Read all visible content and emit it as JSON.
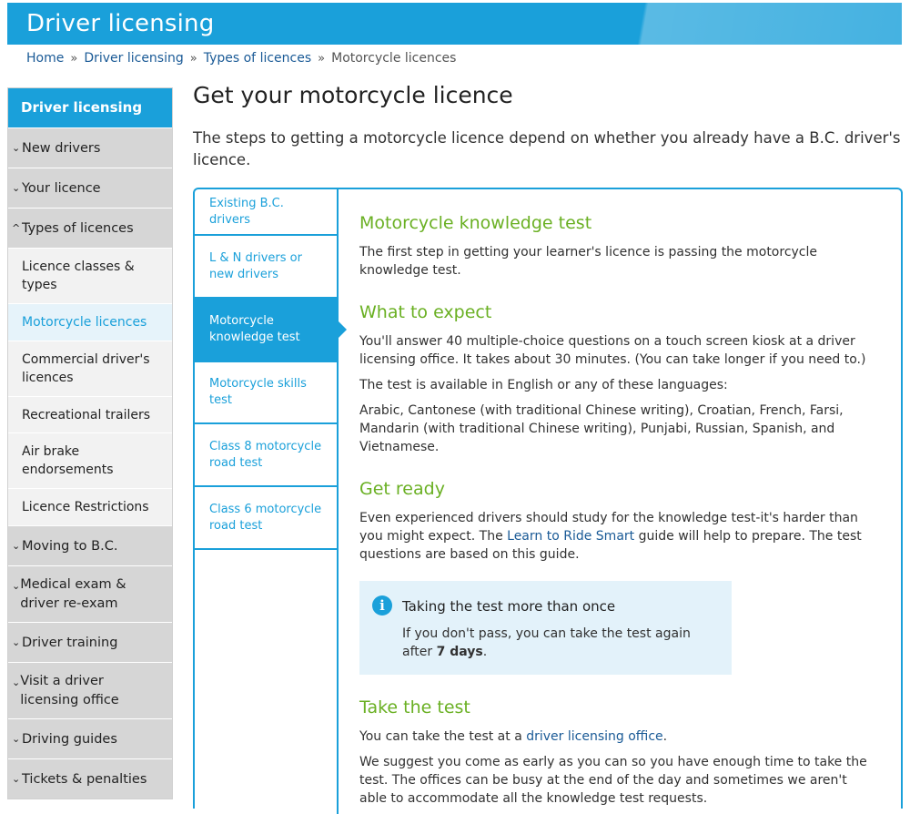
{
  "header": {
    "title": "Driver licensing"
  },
  "breadcrumb": {
    "items": [
      "Home",
      "Driver licensing",
      "Types of licences"
    ],
    "sep": "»",
    "current": "Motorcycle licences"
  },
  "sidebar": {
    "heading": "Driver licensing",
    "items": [
      {
        "label": "New drivers",
        "caret": "⌄"
      },
      {
        "label": "Your licence",
        "caret": "⌄"
      },
      {
        "label": "Types of licences",
        "caret": "^"
      }
    ],
    "subitems": [
      "Licence classes & types",
      "Motorcycle licences",
      "Commercial driver's licences",
      "Recreational trailers",
      "Air brake endorsements",
      "Licence Restrictions"
    ],
    "items_after": [
      "Moving to B.C.",
      "Medical exam & driver re-exam",
      "Driver training",
      "Visit a driver licensing office",
      "Driving guides",
      "Tickets & penalties"
    ]
  },
  "page": {
    "title": "Get your motorcycle licence",
    "intro": "The steps to getting a motorcycle licence depend on whether you already have a B.C. driver's licence."
  },
  "tabs": [
    "Existing B.C. drivers",
    "L & N drivers or new drivers",
    "Motorcycle knowledge test",
    "Motorcycle skills test",
    "Class 8 motorcycle road test",
    "Class 6 motorcycle road test"
  ],
  "content": {
    "h_knowledge": "Motorcycle knowledge test",
    "p_knowledge": "The first step in getting your learner's licence is passing the motorcycle knowledge test.",
    "h_expect": "What to expect",
    "p_expect1": "You'll answer 40 multiple-choice questions on a touch screen kiosk at a driver licensing office. It takes about 30 minutes. (You can take longer if you need to.)",
    "p_expect2": "The test is available in English or any of these languages:",
    "p_expect3": "Arabic, Cantonese (with traditional Chinese writing), Croatian, French, Farsi, Mandarin (with traditional Chinese writing), Punjabi, Russian, Spanish, and Vietnamese.",
    "h_ready": "Get ready",
    "p_ready_a": "Even experienced drivers should study for the knowledge test-it's harder than you might expect. The ",
    "p_ready_link": "Learn to Ride Smart",
    "p_ready_b": " guide will help to prepare. The test questions are based on this guide.",
    "info_icon": "i",
    "info_title": "Taking the test more than once",
    "info_body_a": "If you don't pass, you can take the test again after ",
    "info_body_bold": "7 days",
    "info_body_b": ".",
    "h_take": "Take the test",
    "p_take_a": "You can take the test at a ",
    "p_take_link": "driver licensing office",
    "p_take_b": ".",
    "p_suggest": "We suggest you come as early as you can so you have enough time to take the test. The offices can be busy at the end of the day and sometimes we aren't able to accommodate all the knowledge test requests."
  },
  "colors": {
    "brand_blue": "#1aa0da",
    "heading_green": "#6ab023",
    "link": "#1a5a96",
    "info_bg": "#e3f2fa"
  }
}
